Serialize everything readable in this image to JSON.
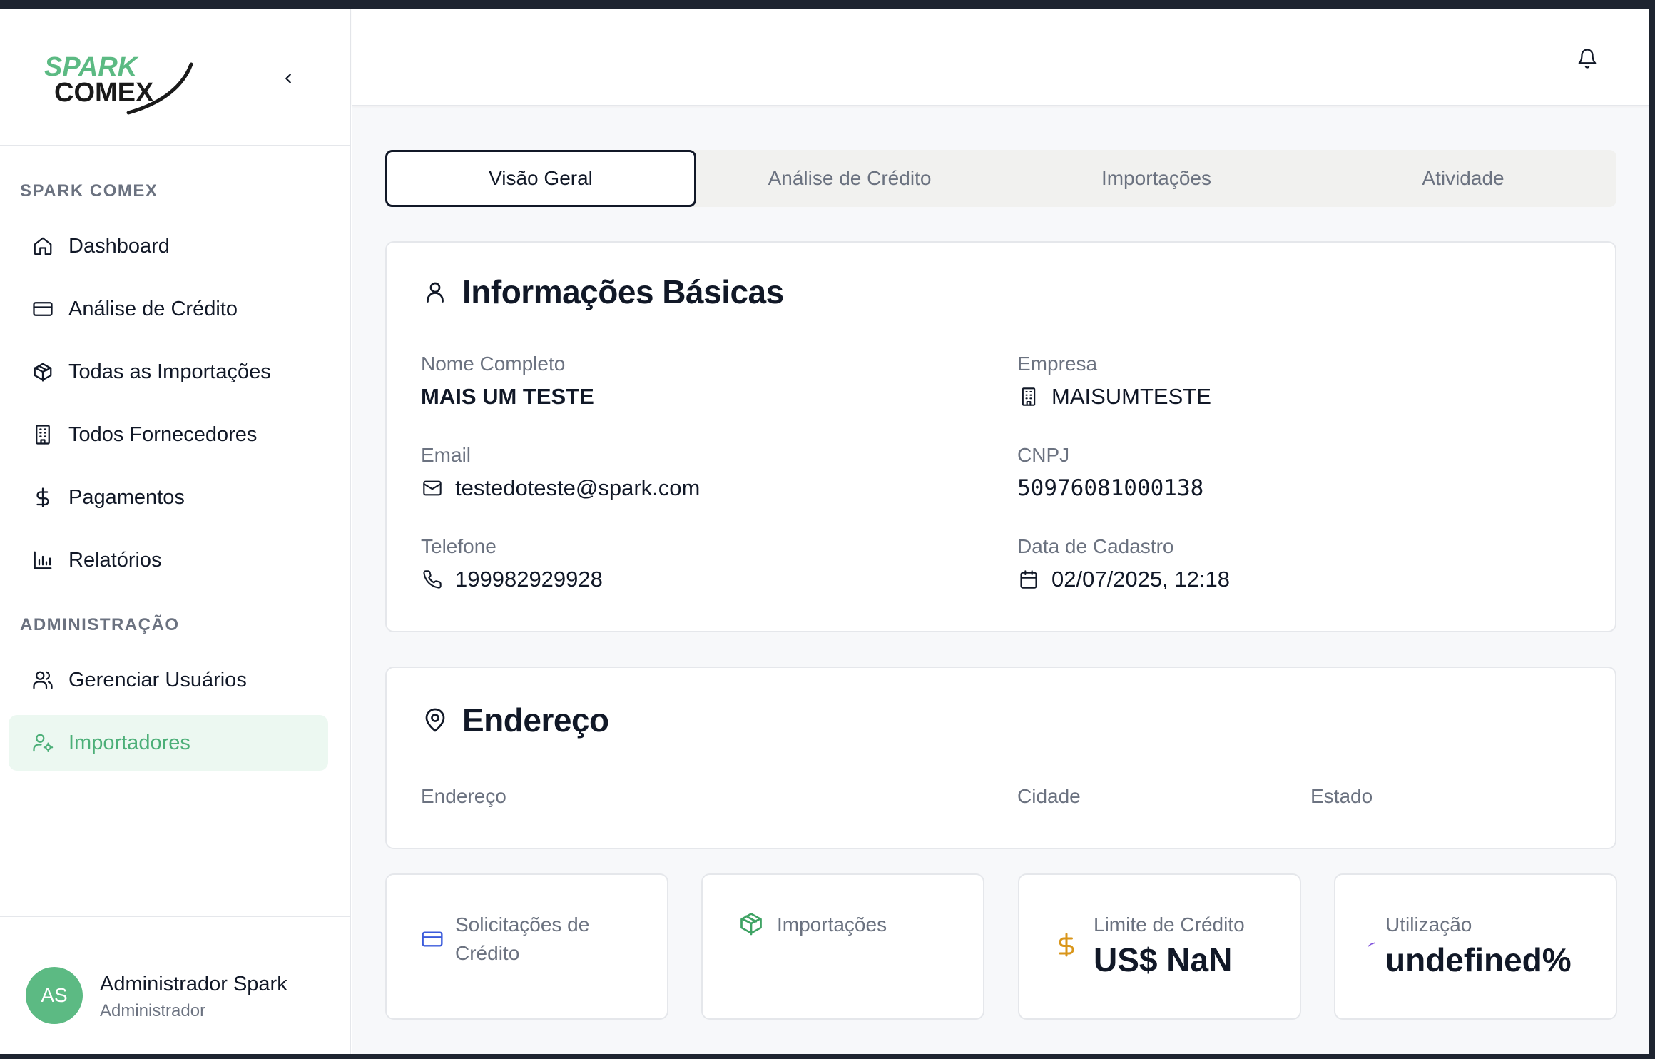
{
  "brand": {
    "logo_line1": "SPARK",
    "logo_line2": "COMEX",
    "primary_color": "#4caf78",
    "avatar_color": "#5cba83"
  },
  "sidebar": {
    "section1": "SPARK COMEX",
    "items": [
      {
        "label": "Dashboard",
        "icon": "home-icon"
      },
      {
        "label": "Análise de Crédito",
        "icon": "credit-card-icon"
      },
      {
        "label": "Todas as Importações",
        "icon": "package-icon"
      },
      {
        "label": "Todos Fornecedores",
        "icon": "building-icon"
      },
      {
        "label": "Pagamentos",
        "icon": "dollar-icon"
      },
      {
        "label": "Relatórios",
        "icon": "bar-chart-icon"
      }
    ],
    "section2": "ADMINISTRAÇÃO",
    "admin_items": [
      {
        "label": "Gerenciar Usuários",
        "icon": "users-icon"
      },
      {
        "label": "Importadores",
        "icon": "user-cog-icon",
        "active": true
      }
    ],
    "user": {
      "initials": "AS",
      "name": "Administrador Spark",
      "role": "Administrador"
    }
  },
  "tabs": [
    "Visão Geral",
    "Análise de Crédito",
    "Importações",
    "Atividade"
  ],
  "basic_info": {
    "title": "Informações Básicas",
    "full_name_label": "Nome Completo",
    "full_name": "MAIS UM TESTE",
    "company_label": "Empresa",
    "company": "MAISUMTESTE",
    "email_label": "Email",
    "email": "testedoteste@spark.com",
    "cnpj_label": "CNPJ",
    "cnpj": "50976081000138",
    "phone_label": "Telefone",
    "phone": "199982929928",
    "registered_label": "Data de Cadastro",
    "registered": "02/07/2025, 12:18"
  },
  "address": {
    "title": "Endereço",
    "street_label": "Endereço",
    "city_label": "Cidade",
    "state_label": "Estado"
  },
  "stats": {
    "credit_requests_label": "Solicitações de Crédito",
    "imports_label": "Importações",
    "credit_limit_label": "Limite de Crédito",
    "credit_limit_value": "US$ NaN",
    "usage_label": "Utilização",
    "usage_value": "undefined%"
  }
}
